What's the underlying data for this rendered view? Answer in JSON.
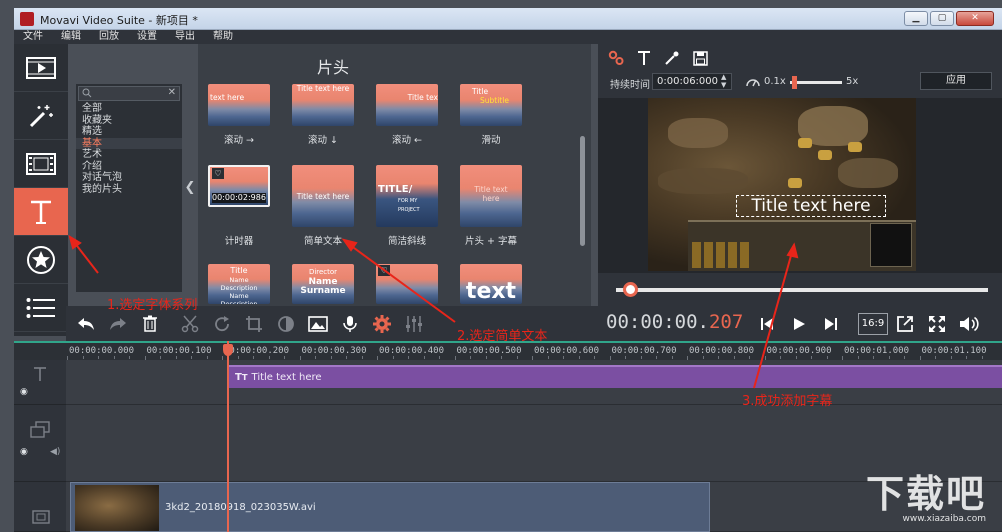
{
  "window": {
    "title": "Movavi Video Suite - 新项目 *",
    "min": "▁",
    "max": "▢",
    "close": "✕"
  },
  "menu": [
    "文件",
    "编辑",
    "回放",
    "设置",
    "导出",
    "帮助"
  ],
  "left_tools": [
    "media-icon",
    "magic-wand-icon",
    "filmstrip-icon",
    "titles-icon",
    "stickers-icon",
    "list-icon"
  ],
  "categories": {
    "items": [
      "全部",
      "收藏夹",
      "精选",
      "基本",
      "艺术",
      "介绍",
      "对话气泡",
      "我的片头"
    ],
    "selected": "基本"
  },
  "grid": {
    "heading": "片头",
    "tiles": [
      {
        "label": "滚动 →",
        "text": "text here",
        "sub": ""
      },
      {
        "label": "滚动 ↓",
        "text": "Title text here",
        "sub": ""
      },
      {
        "label": "滚动 ←",
        "text": "Title tex",
        "sub": ""
      },
      {
        "label": "滑动",
        "text": "Title",
        "sub": "Subtitle"
      },
      {
        "label": "计时器",
        "text": "",
        "sub": "",
        "time": "00:00:02:986"
      },
      {
        "label": "简单文本",
        "text": "Title text here",
        "sub": ""
      },
      {
        "label": "简洁斜线",
        "text": "TITLE/",
        "sub": "FOR MY PROJECT"
      },
      {
        "label": "片头 + 字幕",
        "text": "Title text here",
        "sub": ""
      },
      {
        "label": "",
        "text": "Title",
        "sub": "Name Description Name Description"
      },
      {
        "label": "",
        "text": "Director",
        "sub": "Name Surname"
      },
      {
        "label": "",
        "text": "",
        "sub": ""
      },
      {
        "label": "",
        "text": "text",
        "sub": ""
      }
    ]
  },
  "props": {
    "duration_label": "持续时间",
    "duration_value": "0:00:06:000",
    "speed_min": "0.1x",
    "speed_max": "5x",
    "speed_level": 0.05,
    "apply": "应用"
  },
  "preview": {
    "overlay_text": "Title text here",
    "progress": 0.02
  },
  "playback": {
    "time_main": "00:00:00.",
    "time_ms": "207",
    "ratio": "16:9"
  },
  "ruler": [
    "00:00:00.000",
    "00:00:00.100",
    "00:00:00.200",
    "00:00:00.300",
    "00:00:00.400",
    "00:00:00.500",
    "00:00:00.600",
    "00:00:00.700",
    "00:00:00.800",
    "00:00:00.900",
    "00:00:01.000",
    "00:00:01.100"
  ],
  "timeline": {
    "title_clip": "Title text here",
    "video_clip": "3kd2_20180918_023035W.avi"
  },
  "annotations": {
    "a1": "1.选定字体系列",
    "a2": "2.选定简单文本",
    "a3": "3.成功添加字幕"
  },
  "watermark": {
    "big": "下载吧",
    "small": "www.xiazaiba.com"
  },
  "colors": {
    "accent": "#e8664f",
    "title_clip": "#7b4fa2",
    "annotation": "#e8251a"
  }
}
